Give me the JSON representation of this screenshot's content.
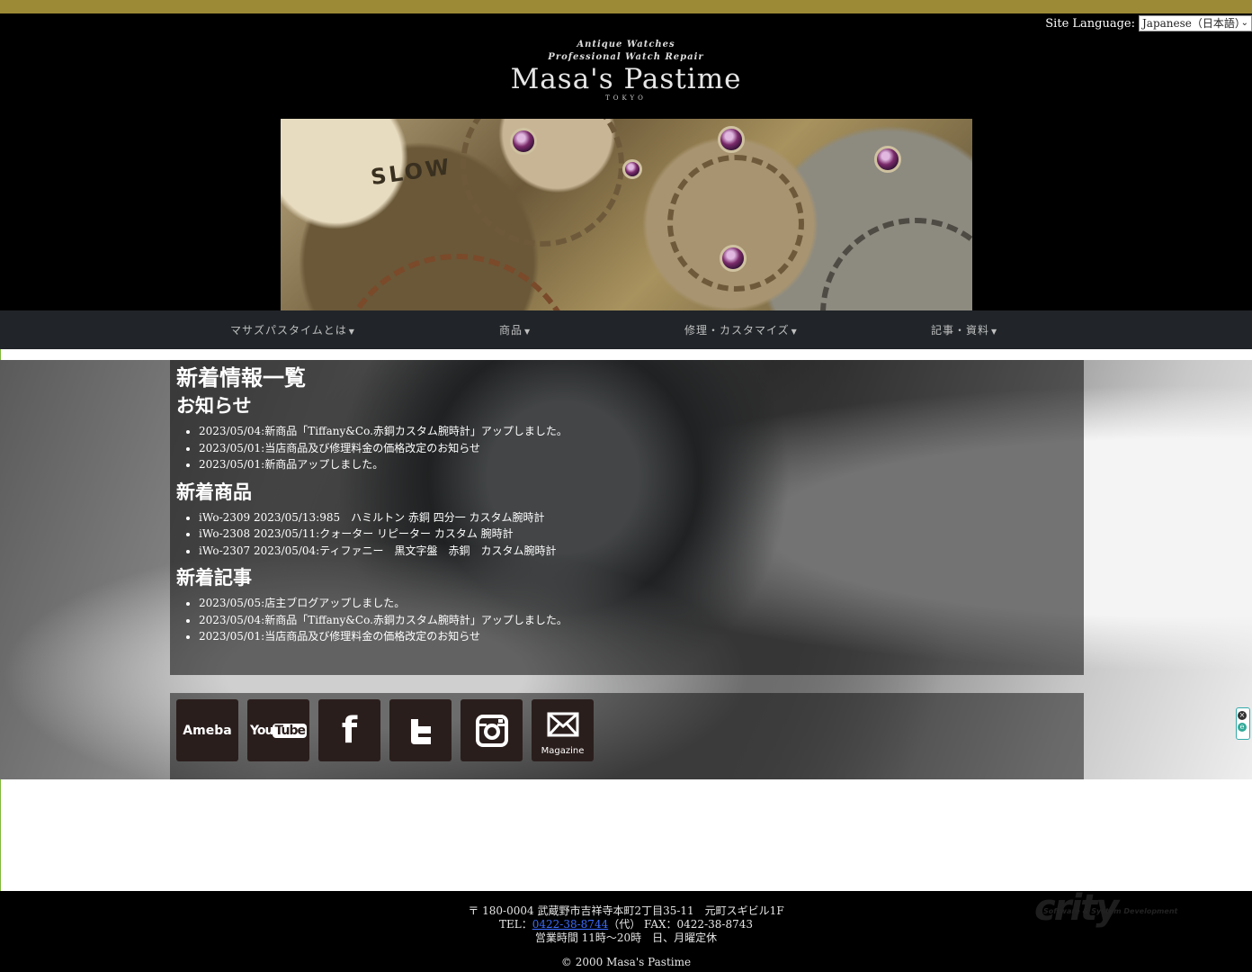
{
  "header": {
    "language_label": "Site Language:",
    "language_value": "Japanese（日本語）",
    "logo_tagline_1": "Antique Watches",
    "logo_tagline_2": "Professional Watch Repair",
    "logo_name": "Masa's Pastime",
    "logo_city": "TOKYO",
    "banner_text": "SLOW"
  },
  "nav": {
    "items": [
      {
        "label": "マサズパスタイムとは"
      },
      {
        "label": "商品"
      },
      {
        "label": "修理・カスタマイズ"
      },
      {
        "label": "記事・資料"
      }
    ]
  },
  "main": {
    "page_title": "新着情報一覧",
    "sections": [
      {
        "title": "お知らせ",
        "items": [
          "2023/05/04:新商品「Tiffany&Co.赤銅カスタム腕時計」アップしました。",
          "2023/05/01:当店商品及び修理料金の価格改定のお知らせ",
          "2023/05/01:新商品アップしました。"
        ]
      },
      {
        "title": "新着商品",
        "items": [
          "iWo-2309 2023/05/13:985　ハミルトン 赤銅 四分一 カスタム腕時計",
          "iWo-2308 2023/05/11:クォーター リピーター カスタム 腕時計",
          "iWo-2307 2023/05/04:ティファニー　黒文字盤　赤銅　カスタム腕時計"
        ]
      },
      {
        "title": "新着記事",
        "items": [
          "2023/05/05:店主ブログアップしました。",
          "2023/05/04:新商品「Tiffany&Co.赤銅カスタム腕時計」アップしました。",
          "2023/05/01:当店商品及び修理料金の価格改定のお知らせ"
        ]
      }
    ]
  },
  "social": {
    "ameba": "Ameba",
    "youtube_you": "You",
    "youtube_tube": "Tube",
    "facebook": "f",
    "magazine": "Magazine"
  },
  "footer": {
    "address": "〒 180-0004 武蔵野市吉祥寺本町2丁目35-11　元町スギビル1F",
    "tel_prefix": "TEL：",
    "tel": "0422-38-8744",
    "tel_suffix": "（代） FAX：0422-38-8743",
    "hours": "営業時間 11時〜20時　日、月曜定休",
    "copyright": "© 2000 Masa's Pastime",
    "ghost_logo": "crity",
    "ghost_sub": "Software & System Development"
  },
  "colors": {
    "top_bar": "#9c8a36",
    "nav_bg": "#212529",
    "footer_bg": "#000000",
    "link": "#3b6cff"
  }
}
